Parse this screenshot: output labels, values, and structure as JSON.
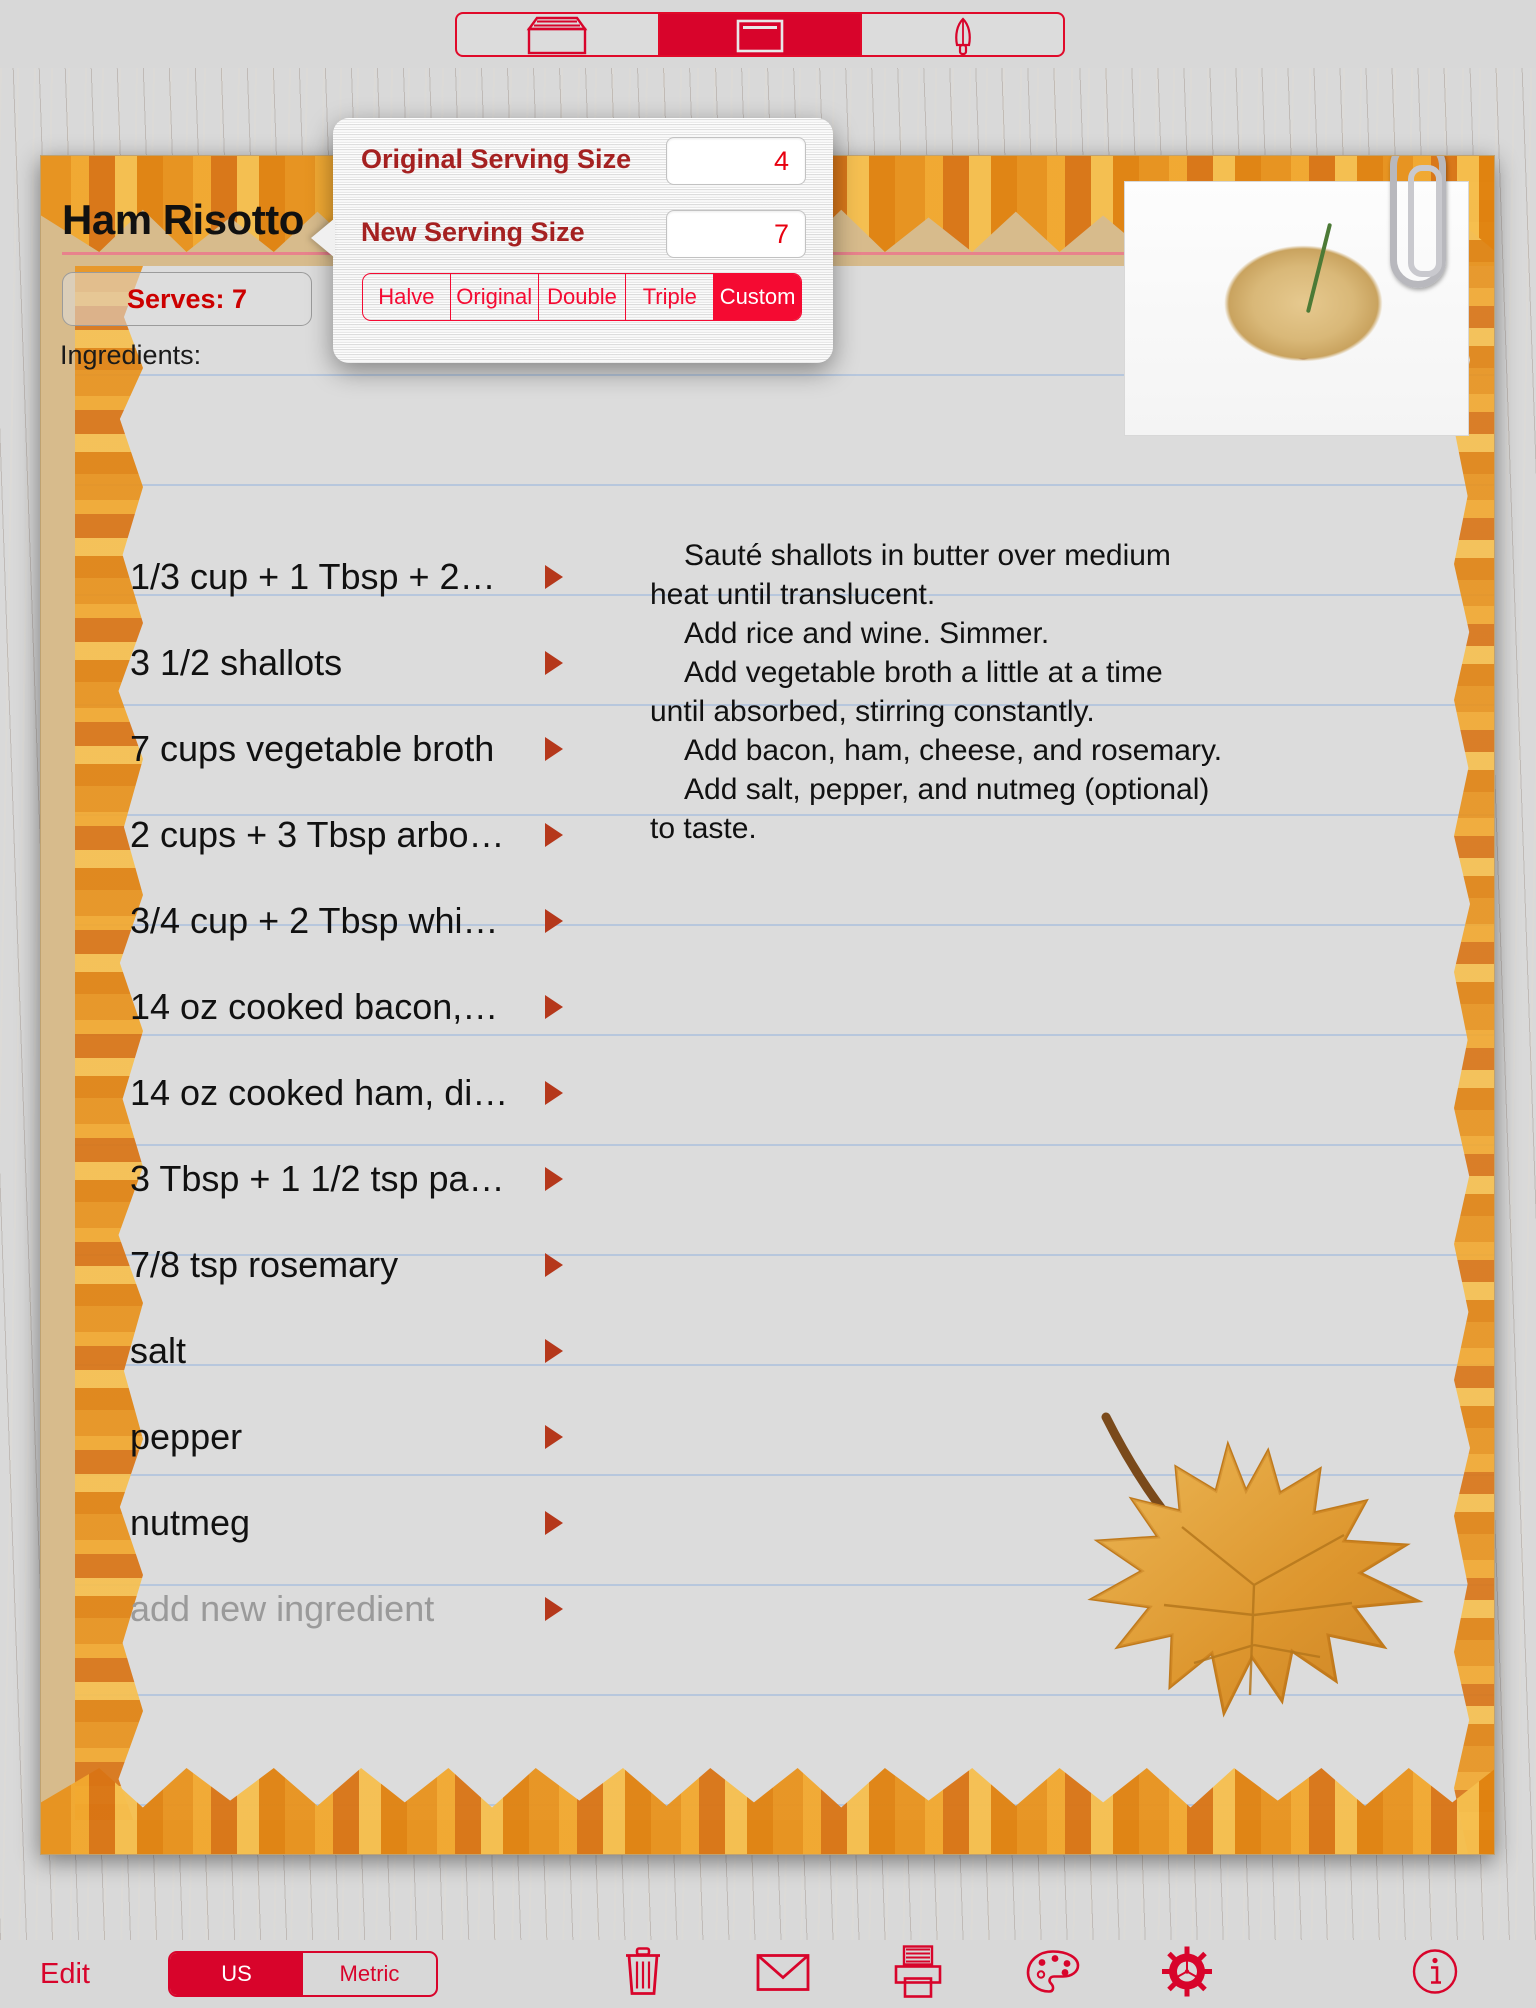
{
  "topbar": {
    "segments": [
      {
        "name": "recipe-box",
        "icon": "recipe-box-icon",
        "selected": false
      },
      {
        "name": "recipe-card",
        "icon": "recipe-card-icon",
        "selected": true
      },
      {
        "name": "utensils",
        "icon": "whisk-icon",
        "selected": false
      }
    ]
  },
  "recipe": {
    "title": "Ham Risotto",
    "serves_label": "Serves: 7",
    "ingredients_label": "Ingredients:",
    "ingredients": [
      {
        "text": "1/3 cup + 1 Tbsp + 2…"
      },
      {
        "text": "3 1/2 shallots"
      },
      {
        "text": "7 cups vegetable broth"
      },
      {
        "text": "2 cups + 3 Tbsp arbo…"
      },
      {
        "text": "3/4 cup + 2 Tbsp whi…"
      },
      {
        "text": "14 oz cooked bacon,…"
      },
      {
        "text": "14 oz cooked ham, di…"
      },
      {
        "text": "3 Tbsp + 1 1/2 tsp pa…"
      },
      {
        "text": "7/8 tsp rosemary"
      },
      {
        "text": "salt"
      },
      {
        "text": "pepper"
      },
      {
        "text": "nutmeg"
      }
    ],
    "add_new_ingredient": "add new ingredient",
    "directions": [
      "Sauté shallots in butter over medium heat until translucent.",
      "Add rice and wine.  Simmer.",
      "Add vegetable broth a little at a time until absorbed, stirring constantly.",
      "Add bacon, ham, cheese, and rosemary.",
      "Add salt, pepper, and nutmeg (optional) to taste."
    ]
  },
  "popover": {
    "original_label": "Original Serving Size",
    "original_value": "4",
    "new_label": "New Serving Size",
    "new_value": "7",
    "scale_options": [
      {
        "label": "Halve",
        "selected": false
      },
      {
        "label": "Original",
        "selected": false
      },
      {
        "label": "Double",
        "selected": false
      },
      {
        "label": "Triple",
        "selected": false
      },
      {
        "label": "Custom",
        "selected": true
      }
    ]
  },
  "bottombar": {
    "edit_label": "Edit",
    "units": [
      {
        "label": "US",
        "selected": true
      },
      {
        "label": "Metric",
        "selected": false
      }
    ],
    "icons": [
      {
        "name": "trash-icon"
      },
      {
        "name": "mail-icon"
      },
      {
        "name": "print-icon"
      },
      {
        "name": "palette-icon"
      },
      {
        "name": "gear-icon"
      },
      {
        "name": "info-icon"
      }
    ]
  },
  "colors": {
    "accent_red": "#d8042b",
    "label_red": "#a52121",
    "value_red": "#e8000f",
    "paper": "#dcdcdc"
  }
}
